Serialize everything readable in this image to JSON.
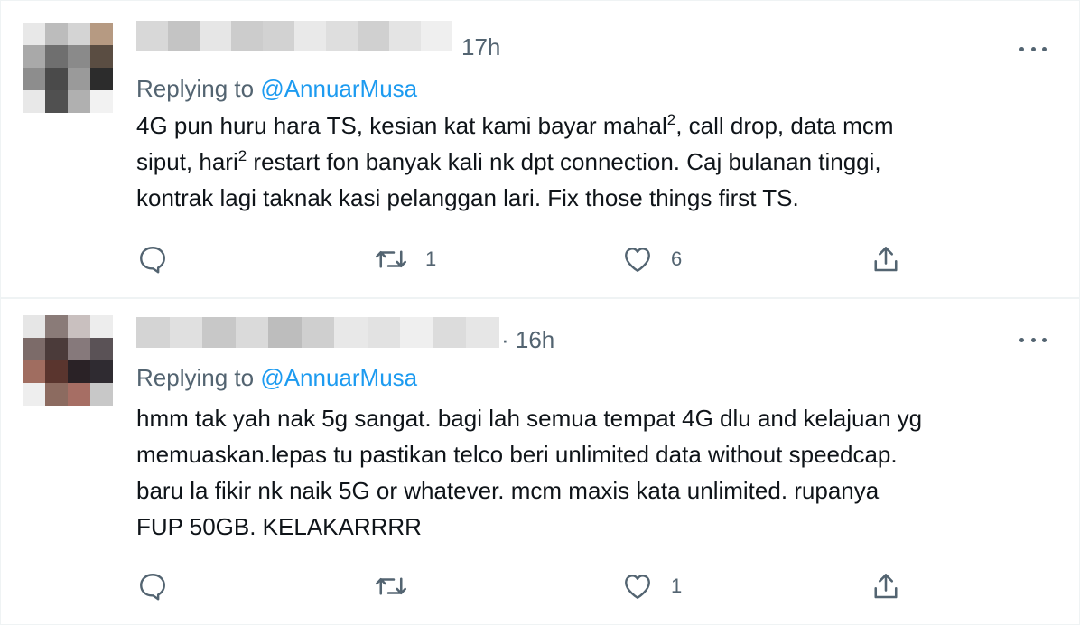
{
  "tweets": [
    {
      "time": "17h",
      "replying_prefix": "Replying to",
      "replying_handle": "@AnnuarMusa",
      "lines": [
        [
          "4G pun huru hara TS, kesian kat kami bayar mahal",
          "2",
          ", call drop, data mcm"
        ],
        [
          "siput, hari",
          "2",
          " restart fon banyak kali nk dpt connection. Caj bulanan tinggi,"
        ],
        [
          "kontrak lagi taknak kasi pelanggan lari. Fix those things first TS.",
          "",
          ""
        ]
      ],
      "replies": "",
      "retweets": "1",
      "likes": "6",
      "avatar_colors": [
        "#e8e8e8",
        "#bcbcbc",
        "#d4d4d4",
        "#b69a82",
        "#a9a9a9",
        "#6f6f6f",
        "#8a8a8a",
        "#5a4d42",
        "#8d8d8d",
        "#4a4a4a",
        "#9a9a9a",
        "#2c2c2c",
        "#e8e8e8",
        "#505050",
        "#b0b0b0",
        "#f2f2f2"
      ],
      "name_blur_colors": [
        "#d8d8d8",
        "#c4c4c4",
        "#e6e6e6",
        "#cccccc",
        "#d2d2d2",
        "#e9e9e9",
        "#dedede",
        "#d0d0d0",
        "#e4e4e4",
        "#efefef"
      ]
    },
    {
      "time": "· 16h",
      "replying_prefix": "Replying to",
      "replying_handle": "@AnnuarMusa",
      "lines": [
        [
          "hmm tak yah nak 5g sangat. bagi  lah semua tempat 4G dlu and kelajuan yg",
          "",
          ""
        ],
        [
          "memuaskan.lepas tu pastikan telco beri unlimited data without speedcap.",
          "",
          ""
        ],
        [
          "baru la fikir nk naik 5G or whatever. mcm maxis kata unlimited. rupanya",
          "",
          ""
        ],
        [
          "FUP 50GB. KELAKARRRR",
          "",
          ""
        ]
      ],
      "replies": "",
      "retweets": "",
      "likes": "1",
      "avatar_colors": [
        "#e6e6e6",
        "#8a7b78",
        "#c9c0bf",
        "#ededed",
        "#7c6b69",
        "#4b3b3a",
        "#86797b",
        "#5a5256",
        "#a06d60",
        "#5a352e",
        "#2a2226",
        "#2f2b31",
        "#eeeeee",
        "#8c6b60",
        "#a66e64",
        "#c8c8c8"
      ],
      "name_blur_colors": [
        "#d4d4d4",
        "#e0e0e0",
        "#c8c8c8",
        "#dadada",
        "#bdbdbd",
        "#cfcfcf",
        "#e8e8e8",
        "#e2e2e2",
        "#efefef",
        "#dcdcdc",
        "#e6e6e6"
      ]
    }
  ],
  "icons": {
    "reply": "reply-icon",
    "retweet": "retweet-icon",
    "like": "like-icon",
    "share": "share-icon",
    "more": "more-icon"
  },
  "colors": {
    "text": "#0f1419",
    "secondary": "#536471",
    "link": "#1d9bf0",
    "divider": "#eff3f4"
  }
}
